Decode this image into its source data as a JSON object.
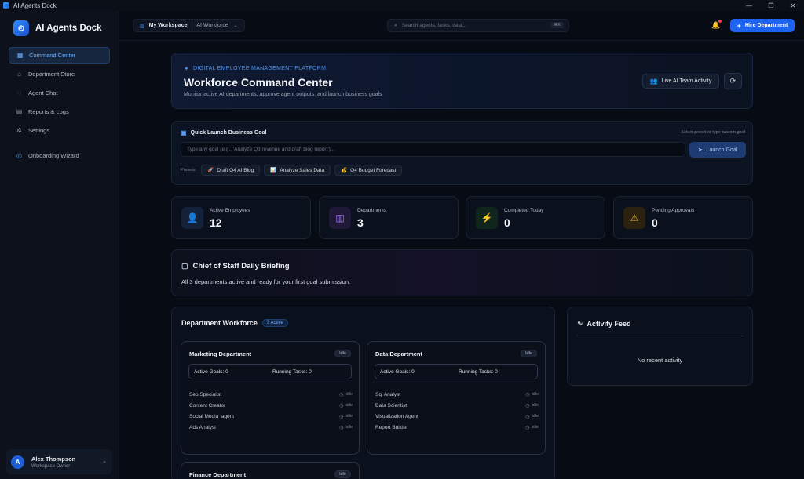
{
  "window": {
    "title": "AI Agents Dock",
    "controls": [
      "—",
      "❐",
      "✕"
    ]
  },
  "brand": {
    "name": "AI Agents Dock"
  },
  "sidebar": {
    "items": [
      {
        "label": "Command Center",
        "icon": "grid-icon",
        "active": true
      },
      {
        "label": "Department Store",
        "icon": "store-icon"
      },
      {
        "label": "Agent Chat",
        "icon": "chat-icon"
      },
      {
        "label": "Reports & Logs",
        "icon": "file-icon"
      },
      {
        "label": "Settings",
        "icon": "gear-icon"
      }
    ],
    "onboarding": {
      "label": "Onboarding Wizard",
      "icon": "compass-icon"
    }
  },
  "user": {
    "initial": "A",
    "name": "Alex Thompson",
    "role": "Workspace Owner"
  },
  "topbar": {
    "workspace": "My Workspace",
    "workspace_sub": "AI Workforce",
    "search_placeholder": "Search agents, tasks, data...",
    "search_shortcut": "⌘K",
    "hire_label": "Hire Department"
  },
  "hero": {
    "kicker": "DIGITAL EMPLOYEE MANAGEMENT PLATFORM",
    "title": "Workforce Command Center",
    "subtitle": "Monitor active AI departments, approve agent outputs, and launch business goals",
    "live_label": "Live AI Team Activity"
  },
  "quick_launch": {
    "title": "Quick Launch Business Goal",
    "hint": "Select preset or type custom goal",
    "placeholder": "Type any goal (e.g., 'Analyze Q3 revenue and draft blog report')...",
    "launch_label": "Launch Goal",
    "presets_label": "Presets:",
    "presets": [
      {
        "icon": "🚀",
        "label": "Draft Q4 AI Blog"
      },
      {
        "icon": "📊",
        "label": "Analyze Sales Data"
      },
      {
        "icon": "💰",
        "label": "Q4 Budget Forecast"
      }
    ]
  },
  "stats": [
    {
      "label": "Active Employees",
      "value": "12",
      "icon": "users-icon",
      "color": "#4d8fe8"
    },
    {
      "label": "Departments",
      "value": "3",
      "icon": "building-icon",
      "color": "#a078f0"
    },
    {
      "label": "Completed Today",
      "value": "0",
      "icon": "bolt-icon",
      "color": "#2fc27a"
    },
    {
      "label": "Pending Approvals",
      "value": "0",
      "icon": "warning-icon",
      "color": "#f0b429"
    }
  ],
  "briefing": {
    "title": "Chief of Staff Daily Briefing",
    "text": "All 3 departments active and ready for your first goal submission."
  },
  "workforce": {
    "title": "Department Workforce",
    "badge": "3 Active",
    "departments": [
      {
        "name": "Marketing Department",
        "status": "Idle",
        "active_goals": "Active Goals: 0",
        "running_tasks": "Running Tasks: 0",
        "agents": [
          {
            "name": "Seo Specialist",
            "status": "idle"
          },
          {
            "name": "Content Creator",
            "status": "idle"
          },
          {
            "name": "Social Media_agent",
            "status": "idle"
          },
          {
            "name": "Ads Analyst",
            "status": "idle"
          }
        ]
      },
      {
        "name": "Data Department",
        "status": "Idle",
        "active_goals": "Active Goals: 0",
        "running_tasks": "Running Tasks: 0",
        "agents": [
          {
            "name": "Sql Analyst",
            "status": "idle"
          },
          {
            "name": "Data Scientist",
            "status": "idle"
          },
          {
            "name": "Visualization Agent",
            "status": "idle"
          },
          {
            "name": "Report Builder",
            "status": "idle"
          }
        ]
      },
      {
        "name": "Finance Department",
        "status": "Idle"
      }
    ]
  },
  "activity": {
    "title": "Activity Feed",
    "empty": "No recent activity"
  },
  "colors": {
    "accent": "#1d63f0",
    "background": "#070b14",
    "panel": "#0b111c"
  }
}
